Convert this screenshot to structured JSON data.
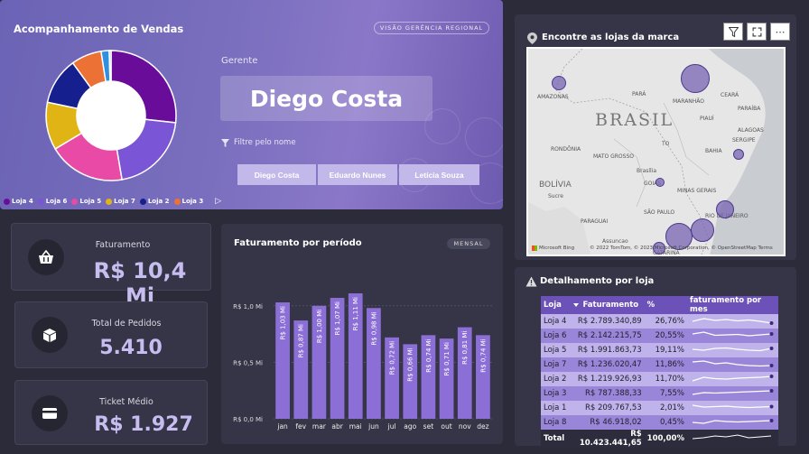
{
  "hero": {
    "title": "Acompanhamento de Vendas",
    "badge": "VISÃO GERÊNCIA REGIONAL",
    "gerente_label": "Gerente",
    "gerente_name": "Diego Costa",
    "filter_label": "Filtre pelo nome",
    "manager_buttons": [
      "Diego Costa",
      "Eduardo Nunes",
      "Letícia Souza"
    ],
    "legend": [
      {
        "label": "Loja 4",
        "color": "#6a0c9a"
      },
      {
        "label": "Loja 6",
        "color": "#7a55d6"
      },
      {
        "label": "Loja 5",
        "color": "#e94aa6"
      },
      {
        "label": "Loja 7",
        "color": "#e1b416"
      },
      {
        "label": "Loja 2",
        "color": "#15208e"
      },
      {
        "label": "Loja 3",
        "color": "#ec7135"
      }
    ],
    "legend_next": "▷"
  },
  "donut_data": {
    "type": "pie",
    "categories": [
      "Loja 4",
      "Loja 6",
      "Loja 5",
      "Loja 7",
      "Loja 2",
      "Loja 3",
      "Loja 1",
      "Loja 8"
    ],
    "values": [
      26.76,
      20.55,
      19.11,
      11.86,
      11.7,
      7.55,
      2.01,
      0.45
    ],
    "colors": [
      "#6a0c9a",
      "#7a55d6",
      "#e94aa6",
      "#e1b416",
      "#15208e",
      "#ec7135",
      "#2f8fe0",
      "#9aa0b0"
    ]
  },
  "kpis": {
    "faturamento": {
      "label": "Faturamento",
      "value": "R$ 10,4 Mi",
      "icon": "basket-icon"
    },
    "pedidos": {
      "label": "Total de Pedidos",
      "value": "5.410",
      "icon": "box-icon"
    },
    "ticket": {
      "label": "Ticket Médio",
      "value": "R$ 1.927",
      "icon": "wallet-icon"
    }
  },
  "chart_data": {
    "type": "bar",
    "title": "Faturamento por período",
    "badge": "MENSAL",
    "categories": [
      "jan",
      "fev",
      "mar",
      "abr",
      "mai",
      "jun",
      "jul",
      "ago",
      "set",
      "out",
      "nov",
      "dez"
    ],
    "values": [
      1.03,
      0.87,
      1.0,
      1.07,
      1.11,
      0.98,
      0.72,
      0.66,
      0.74,
      0.71,
      0.81,
      0.74
    ],
    "labels": [
      "R$ 1,03 Mi",
      "R$ 0,87 Mi",
      "R$ 1,00 Mi",
      "R$ 1,07 Mi",
      "R$ 1,11 Mi",
      "R$ 0,98 Mi",
      "R$ 0,72 Mi",
      "R$ 0,66 Mi",
      "R$ 0,74 Mi",
      "R$ 0,71 Mi",
      "R$ 0,81 Mi",
      "R$ 0,74 Mi"
    ],
    "yticks": [
      {
        "v": 0,
        "label": "R$ 0,0 Mi"
      },
      {
        "v": 0.5,
        "label": "R$ 0,5 Mi"
      },
      {
        "v": 1.0,
        "label": "R$ 1,0 Mi"
      }
    ],
    "ylim": [
      0,
      1.15
    ],
    "bar_color": "#8c6fd6"
  },
  "map": {
    "title": "Encontre as lojas da marca",
    "country": "BRASIL",
    "labels": [
      "AMAZONAS",
      "PARÁ",
      "MARANHÃO",
      "CEARÁ",
      "PIAUÍ",
      "PARAÍBA",
      "ALAGOAS",
      "SERGIPE",
      "BAHIA",
      "RONDÔNIA",
      "MATO GROSSO",
      "TO",
      "Brasília",
      "GOIÁS",
      "MINAS GERAIS",
      "BOLÍVIA",
      "Sucre",
      "PARAGUAI",
      "SÃO PAULO",
      "RIO DE JANEIRO",
      "Assuncao",
      "CATARINA"
    ],
    "attribution": "© 2022 TomTom, © 2023 Microsoft Corporation, © OpenStreetMap  Terms",
    "bing": "Microsoft Bing",
    "tools": {
      "filter": "filter-icon",
      "expand": "expand-icon",
      "more": "⋯"
    }
  },
  "table": {
    "title": "Detalhamento por loja",
    "headers": [
      "Loja",
      "Faturamento",
      "%",
      "faturamento por mes"
    ],
    "rows": [
      [
        "Loja 4",
        "R$ 2.789.340,89",
        "26,76%"
      ],
      [
        "Loja 6",
        "R$ 2.142.215,75",
        "20,55%"
      ],
      [
        "Loja 5",
        "R$ 1.991.863,73",
        "19,11%"
      ],
      [
        "Loja 7",
        "R$ 1.236.020,47",
        "11,86%"
      ],
      [
        "Loja 2",
        "R$ 1.219.926,93",
        "11,70%"
      ],
      [
        "Loja 3",
        "R$ 787.388,33",
        "7,55%"
      ],
      [
        "Loja 1",
        "R$ 209.767,53",
        "2,01%"
      ],
      [
        "Loja 8",
        "R$ 46.918,02",
        "0,45%"
      ]
    ],
    "total": [
      "Total",
      "R$ 10.423.441,65",
      "100,00%"
    ]
  }
}
